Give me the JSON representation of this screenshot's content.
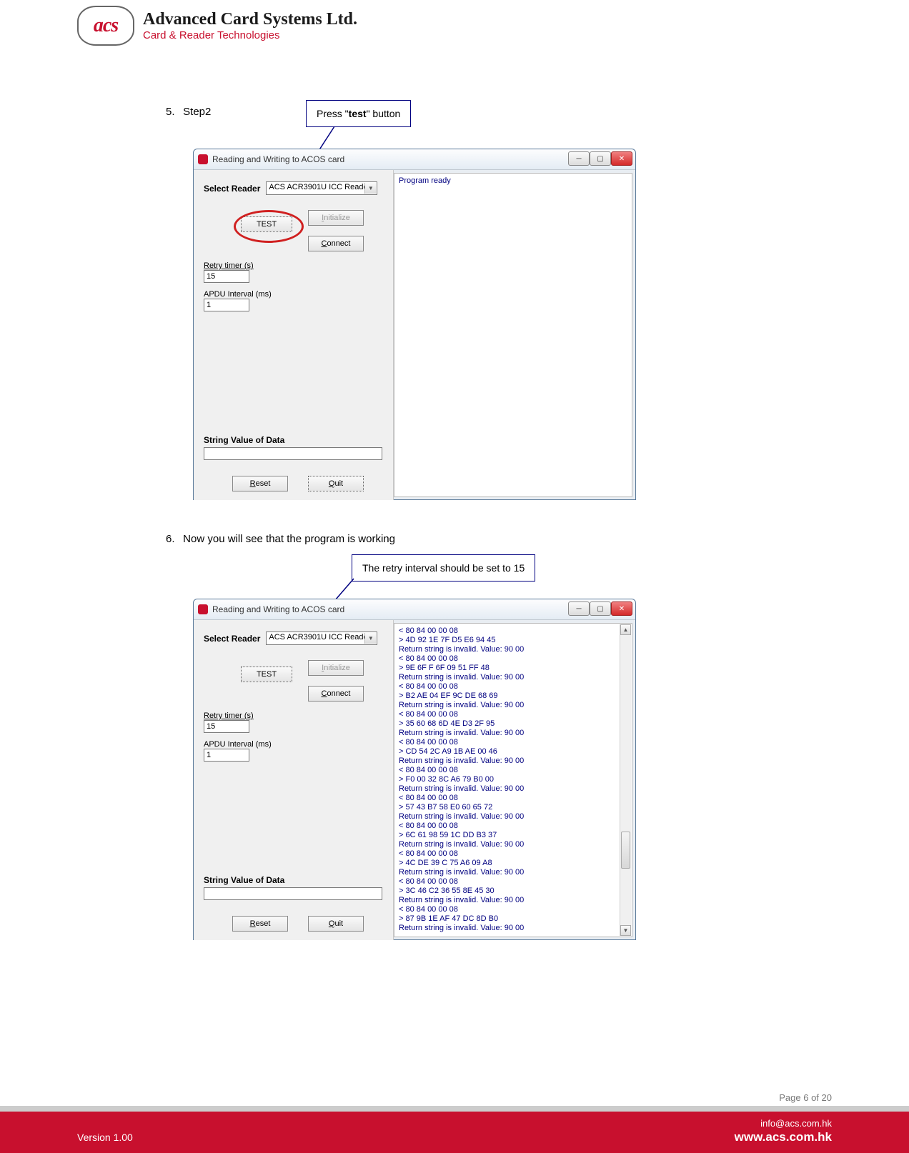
{
  "brand": {
    "logo_text": "acs",
    "title": "Advanced Card Systems Ltd.",
    "subtitle": "Card & Reader Technologies"
  },
  "steps": {
    "five_num": "5.",
    "five_text": "Step2",
    "six_num": "6.",
    "six_text": "Now you will see that the program is working"
  },
  "callouts": {
    "press_test_pre": "Press \"",
    "press_test_bold": "test",
    "press_test_post": "\" button",
    "retry_interval": "The retry interval should be set to 15"
  },
  "window": {
    "title": "Reading and Writing to ACOS card",
    "select_reader": "Select Reader",
    "reader_value": "ACS ACR3901U ICC Reade",
    "btn_test": "TEST",
    "btn_initialize_pre": "I",
    "btn_initialize_rest": "nitialize",
    "btn_connect_pre": "C",
    "btn_connect_rest": "onnect",
    "retry_label": "Retry timer (s)",
    "retry_value": "15",
    "apdu_label": "APDU Interval (ms)",
    "apdu_value": "1",
    "string_label": "String Value of Data",
    "btn_reset_pre": "R",
    "btn_reset_rest": "eset",
    "btn_quit_pre": "Q",
    "btn_quit_rest": "uit",
    "log_ready": "Program ready",
    "log_lines": [
      "< 80 84 00 00 08",
      "> 4D 92 1E 7F D5 E6 94 45",
      "Return string is invalid. Value: 90 00",
      "< 80 84 00 00 08",
      "> 9E 6F F 6F 09 51 FF 48",
      "Return string is invalid. Value: 90 00",
      "< 80 84 00 00 08",
      "> B2 AE 04 EF 9C DE 68 69",
      "Return string is invalid. Value: 90 00",
      "< 80 84 00 00 08",
      "> 35 60 68 6D 4E D3 2F 95",
      "Return string is invalid. Value: 90 00",
      "< 80 84 00 00 08",
      "> CD 54 2C A9 1B AE 00 46",
      "Return string is invalid. Value: 90 00",
      "< 80 84 00 00 08",
      "> F0 00 32 8C A6 79 B0 00",
      "Return string is invalid. Value: 90 00",
      "< 80 84 00 00 08",
      "> 57 43 B7 58 E0 60 65 72",
      "Return string is invalid. Value: 90 00",
      "< 80 84 00 00 08",
      "> 6C 61 98 59 1C DD B3 37",
      "Return string is invalid. Value: 90 00",
      "< 80 84 00 00 08",
      "> 4C DE 39 C 75 A6 09 A8",
      "Return string is invalid. Value: 90 00",
      "< 80 84 00 00 08",
      "> 3C 46 C2 36 55 8E 45 30",
      "Return string is invalid. Value: 90 00",
      "< 80 84 00 00 08",
      "> 87 9B 1E AF 47 DC 8D B0",
      "Return string is invalid. Value: 90 00"
    ]
  },
  "footer": {
    "page": "Page 6 of 20",
    "version": "Version 1.00",
    "email": "info@acs.com.hk",
    "url": "www.acs.com.hk"
  }
}
